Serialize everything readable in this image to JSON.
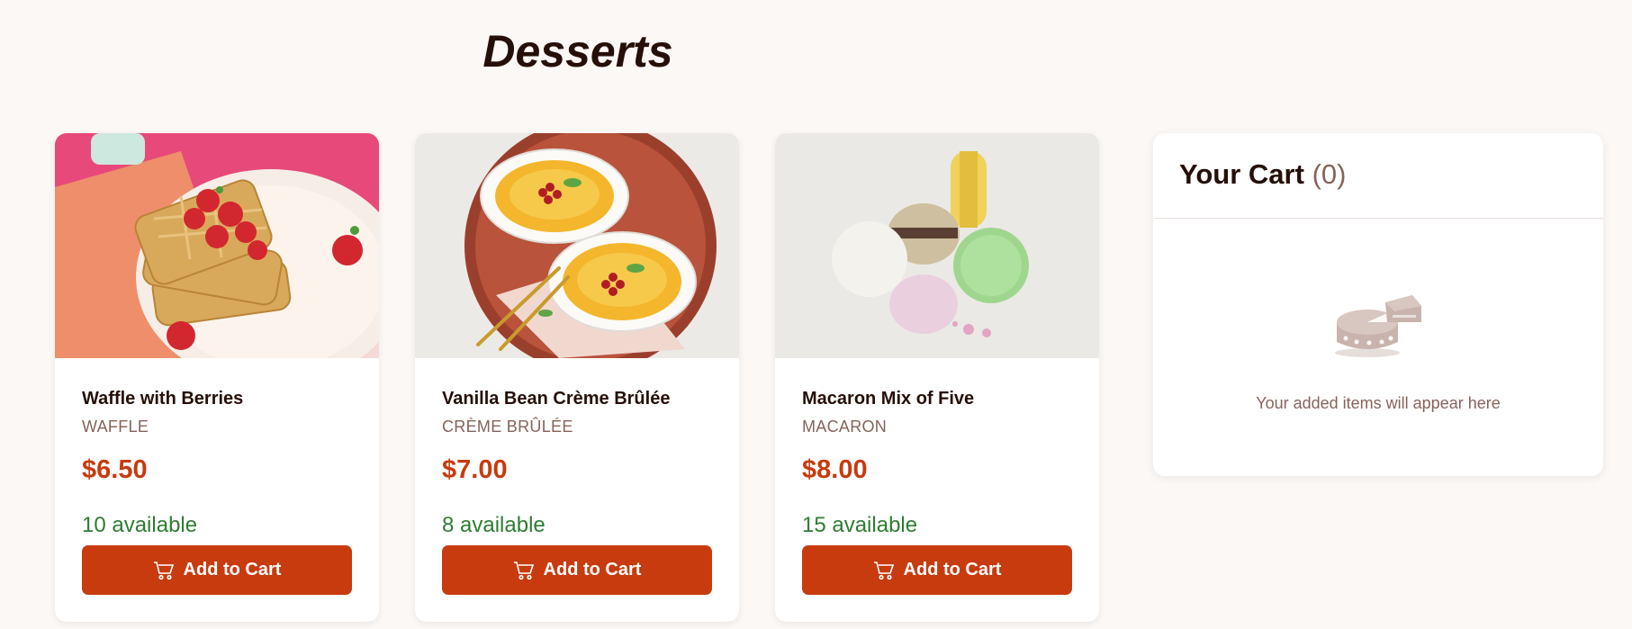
{
  "page": {
    "title": "Desserts"
  },
  "products": [
    {
      "name": "Waffle with Berries",
      "category": "WAFFLE",
      "price": "$6.50",
      "stock": "10 available",
      "button_label": "Add to Cart",
      "image": "waffle-with-berries"
    },
    {
      "name": "Vanilla Bean Crème Brûlée",
      "category": "CRÈME BRÛLÉE",
      "price": "$7.00",
      "stock": "8 available",
      "button_label": "Add to Cart",
      "image": "creme-brulee"
    },
    {
      "name": "Macaron Mix of Five",
      "category": "MACARON",
      "price": "$8.00",
      "stock": "15 available",
      "button_label": "Add to Cart",
      "image": "macarons"
    }
  ],
  "cart": {
    "title": "Your Cart",
    "count": "(0)",
    "empty_message": "Your added items will appear here",
    "empty_icon": "cake-slice-illustration"
  },
  "colors": {
    "background": "#fcf8f6",
    "accent": "#c73b0f",
    "stock_green": "#2e7d32",
    "muted": "#87635a"
  }
}
